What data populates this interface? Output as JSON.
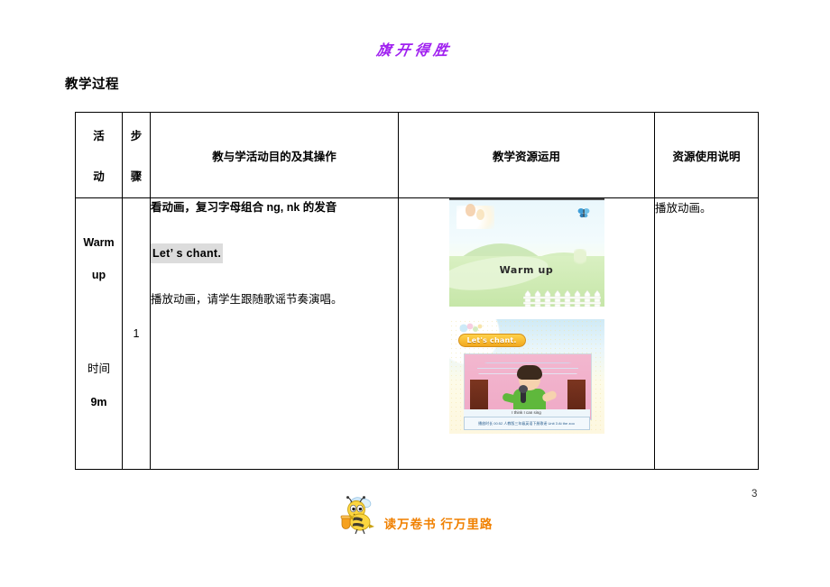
{
  "document": {
    "header_watermark": "旗开得胜",
    "section_title": "教学过程",
    "page_number": "3"
  },
  "table": {
    "headers": {
      "activity": [
        "活",
        "动"
      ],
      "step": [
        "步",
        "骤"
      ],
      "main": "教与学活动目的及其操作",
      "resource": "教学资源运用",
      "note": "资源使用说明"
    },
    "rows": [
      {
        "activity": {
          "name_line1": "Warm",
          "name_line2": "up",
          "time_label": "时间",
          "time_value": "9m"
        },
        "step": "1",
        "main": {
          "objective": "看动画，复习字母组合 ng, nk 的发音",
          "chant_tag": "Let’ s chant.",
          "instruction": "播放动画，请学生跟随歌谣节奏演唱。"
        },
        "resources": [
          {
            "slide_name": "warm-up-landscape-slide",
            "caption": "Warm up"
          },
          {
            "slide_name": "lets-chant-video-slide",
            "banner": "Let's chant.",
            "video_title": "I think I can sing",
            "video_meta": "播放时长  00:52   人教版三年级英语下册歌谣    Unit 3   At the zoo"
          }
        ],
        "note": "播放动画。"
      }
    ]
  },
  "footer": {
    "slogan": "读万卷书 行万里路",
    "mascot": "bee-icon"
  },
  "colors": {
    "watermark": "#a020f0",
    "footer_text": "#f08000",
    "highlight": "#dcdcdc"
  }
}
